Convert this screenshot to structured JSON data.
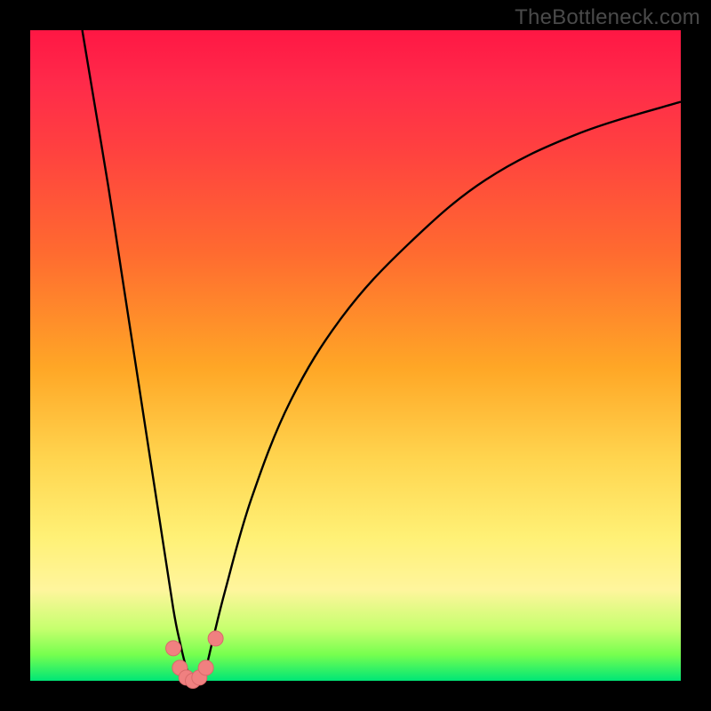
{
  "watermark": "TheBottleneck.com",
  "colors": {
    "frame": "#000000",
    "curve": "#000000",
    "marker_fill": "#f08080",
    "marker_stroke": "#d86a6a"
  },
  "chart_data": {
    "type": "line",
    "title": "",
    "xlabel": "",
    "ylabel": "",
    "xlim": [
      0,
      100
    ],
    "ylim": [
      0,
      100
    ],
    "grid": false,
    "legend": false,
    "series": [
      {
        "name": "bottleneck-curve",
        "x": [
          8,
          10,
          12,
          14,
          16,
          18,
          20,
          22,
          23,
          24,
          25,
          26,
          27,
          28,
          30,
          34,
          40,
          48,
          58,
          70,
          84,
          100
        ],
        "y": [
          100,
          88,
          76,
          63,
          50,
          37,
          24,
          11,
          6,
          2,
          0,
          0,
          2,
          6,
          14,
          28,
          43,
          56,
          67,
          77,
          84,
          89
        ]
      }
    ],
    "markers": {
      "name": "valley-points",
      "x": [
        22.0,
        23.0,
        24.0,
        25.0,
        26.0,
        27.0,
        28.5
      ],
      "y": [
        5.0,
        2.0,
        0.5,
        0.0,
        0.5,
        2.0,
        6.5
      ]
    }
  }
}
